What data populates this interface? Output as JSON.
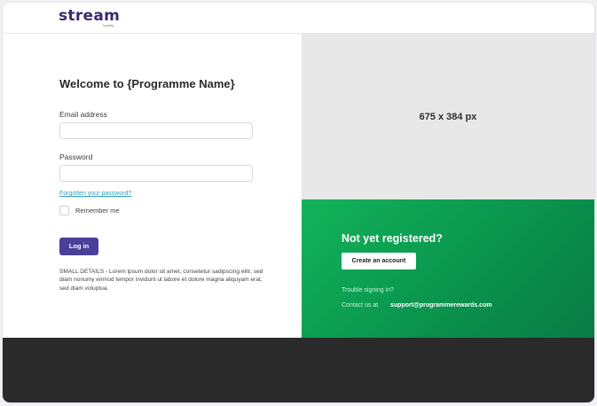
{
  "header": {
    "logo_text": "stream",
    "logo_subtext": "loyalty"
  },
  "login": {
    "title": "Welcome to {Programme Name}",
    "email_label": "Email address",
    "email_value": "",
    "password_label": "Password",
    "password_value": "",
    "forgot_link": "Forgotten your password?",
    "remember_label": "Remember me",
    "login_button": "Log in",
    "small_details": "SMALL DETAILS - Lorem ipsum dolor sit amet, consetetur sadipscing elitr, sed diam nonumy eirmod tempor invidunt ut labore et dolore magna aliquyam erat, sed diam voluptua."
  },
  "image_placeholder": {
    "text": "675 x 384 px"
  },
  "register": {
    "title": "Not yet registered?",
    "create_button": "Create an account",
    "trouble_text": "Trouble signing in?",
    "contact_label": "Contact us at",
    "contact_email": "support@programmerewards.com"
  },
  "colors": {
    "brand_purple": "#4a3f9a",
    "green_panel": "#0b9a4f",
    "link": "#2a9fbf",
    "footer": "#2a2a2a"
  }
}
